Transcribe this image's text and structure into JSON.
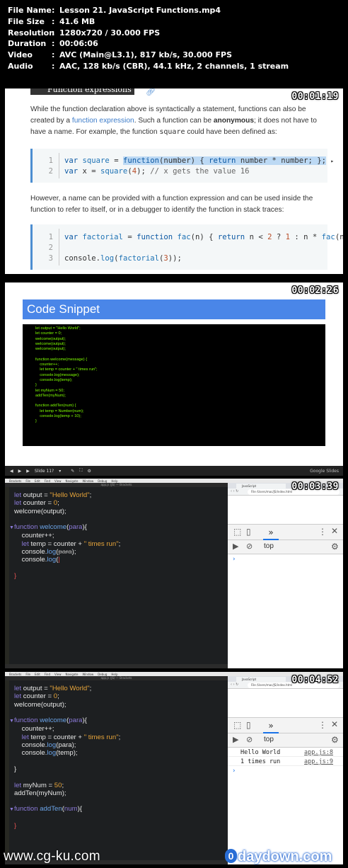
{
  "info": {
    "rows": [
      {
        "key": "File Name",
        "value": "Lesson 21. JavaScript Functions.mp4"
      },
      {
        "key": "File Size",
        "value": "41.6 MB"
      },
      {
        "key": "Resolution",
        "value": "1280x720 / 30.000 FPS"
      },
      {
        "key": "Duration",
        "value": "00:06:06"
      },
      {
        "key": "Video",
        "value": "AVC (Main@L3.1), 817 kb/s, 30.000 FPS"
      },
      {
        "key": "Audio",
        "value": "AAC, 128 kb/s (CBR), 44.1 kHz, 2 channels, 1 stream"
      }
    ],
    "separator": ":"
  },
  "frame1": {
    "timestamp": "00:01:19",
    "heading": "Function expressions",
    "heading_link_icon": "link-icon",
    "para1_a": "While the function declaration above is syntactically a statement, functions can also be created by a ",
    "para1_link": "function expression",
    "para1_b": ". Such a function can be ",
    "para1_bold": "anonymous",
    "para1_c": "; it does not have to have a name. For example, the function ",
    "para1_code": "square",
    "para1_d": " could have been defined as:",
    "code1": {
      "line_numbers": [
        "1",
        "2"
      ]
    },
    "para2": "However, a name can be provided with a function expression and can be used inside the function to refer to itself, or in a debugger to identify the function in stack traces:",
    "code2": {
      "line_numbers": [
        "1",
        "2",
        "3"
      ]
    }
  },
  "frame2": {
    "timestamp": "00:02:26",
    "title": "Code Snippet",
    "snippet": "let output = \"Hello World\";\nlet counter = 0;\nwelcome(output);\nwelcome(output);\nwelcome(output);\n\nfunction welcome(message) {\n    counter++;\n    let temp = counter + \" times run\";\n    console.log(message);\n    console.log(temp);\n}\nlet myNum = 50;\naddTen(myNum);\n\nfunction addTen(num) {\n    let temp = Number(num);\n    console.log(temp + 10);\n}",
    "controls": {
      "slide_label": "Slide 11?",
      "brand": "Google Slides"
    }
  },
  "frame3": {
    "timestamp": "00:03:39",
    "window_title": "app.js (JS) — Brackets",
    "url": "File  /Users/mac/JS/index.html",
    "tab_label": "JavaScript",
    "console_context": "top",
    "console_rows": []
  },
  "frame4": {
    "timestamp": "00:04:52",
    "window_title": "app.js (JS) — Brackets",
    "url": "File  /Users/mac/JS/index.html",
    "tab_label": "JavaScript",
    "console_context": "top",
    "console_rows": [
      {
        "msg": "Hello World",
        "src": "app.js:8"
      },
      {
        "msg": "1 times run",
        "src": "app.js:9"
      }
    ]
  },
  "menubar": [
    "Brackets",
    "File",
    "Edit",
    "Find",
    "View",
    "Navigate",
    "Window",
    "Debug",
    "Help"
  ],
  "watermarks": {
    "left": "www.cg-ku.com",
    "right_prefix": "0",
    "right": "daydown.com"
  }
}
